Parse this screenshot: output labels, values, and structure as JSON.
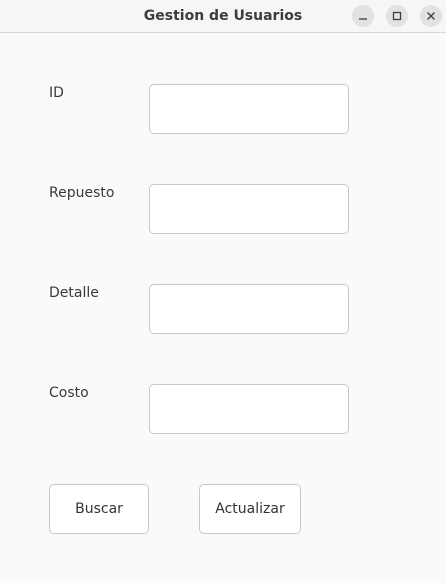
{
  "window": {
    "title": "Gestion de Usuarios"
  },
  "form": {
    "fields": [
      {
        "label": "ID",
        "value": "",
        "placeholder": ""
      },
      {
        "label": "Repuesto",
        "value": "",
        "placeholder": ""
      },
      {
        "label": "Detalle",
        "value": "",
        "placeholder": ""
      },
      {
        "label": "Costo",
        "value": "",
        "placeholder": ""
      }
    ]
  },
  "buttons": {
    "search_label": "Buscar",
    "update_label": "Actualizar"
  },
  "icons": {
    "minimize": "minimize-icon",
    "maximize": "maximize-icon",
    "close": "close-icon"
  }
}
